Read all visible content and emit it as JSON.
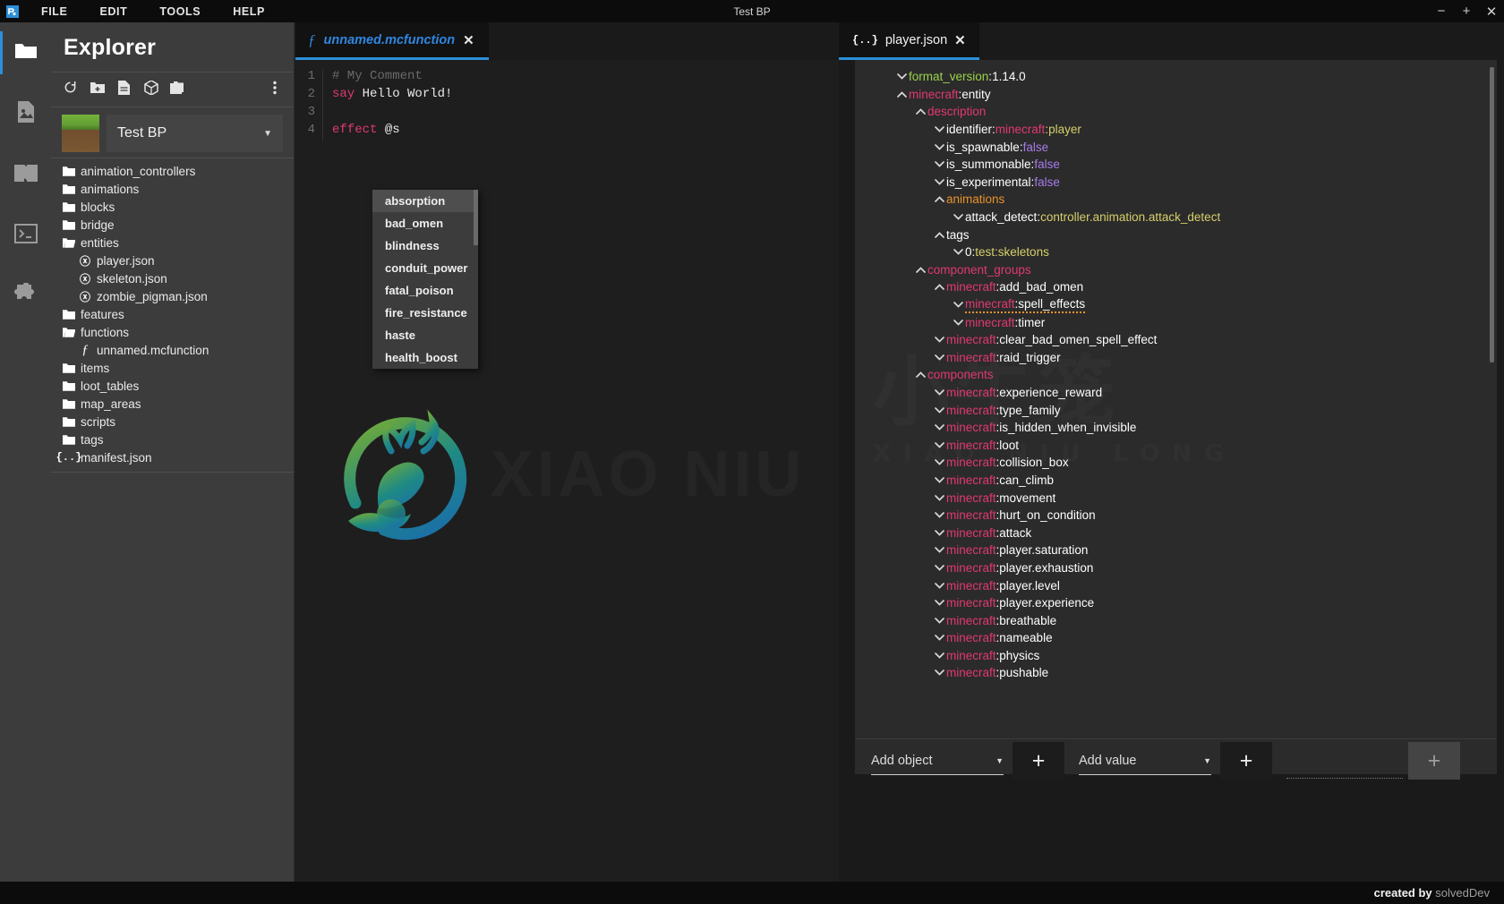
{
  "window": {
    "title": "Test BP",
    "menus": [
      "FILE",
      "EDIT",
      "TOOLS",
      "HELP"
    ],
    "minimize": "−",
    "maximize": "+",
    "close": "✕"
  },
  "rail": {
    "items": [
      {
        "name": "files",
        "icon": "folder-icon",
        "active": true
      },
      {
        "name": "images",
        "icon": "image-file-icon",
        "active": false
      },
      {
        "name": "docs",
        "icon": "book-icon",
        "active": false
      },
      {
        "name": "terminal",
        "icon": "terminal-icon",
        "active": false
      },
      {
        "name": "extensions",
        "icon": "puzzle-icon",
        "active": false
      }
    ]
  },
  "explorer": {
    "title": "Explorer",
    "tools": [
      {
        "name": "refresh",
        "icon": "refresh-icon"
      },
      {
        "name": "new-folder",
        "icon": "new-folder-icon"
      },
      {
        "name": "new-file",
        "icon": "new-file-icon"
      },
      {
        "name": "new-package",
        "icon": "package-icon"
      },
      {
        "name": "open-folder",
        "icon": "folder-open-icon"
      },
      {
        "name": "more-options",
        "icon": "kebab-menu-icon"
      }
    ],
    "project": {
      "name": "Test BP",
      "caret": "▼"
    },
    "tree": [
      {
        "label": "animation_controllers",
        "type": "folder",
        "depth": 0,
        "open": false
      },
      {
        "label": "animations",
        "type": "folder",
        "depth": 0,
        "open": false
      },
      {
        "label": "blocks",
        "type": "folder",
        "depth": 0,
        "open": false
      },
      {
        "label": "bridge",
        "type": "folder",
        "depth": 0,
        "open": false
      },
      {
        "label": "entities",
        "type": "folder",
        "depth": 0,
        "open": true
      },
      {
        "label": "player.json",
        "type": "json",
        "depth": 1,
        "open": false
      },
      {
        "label": "skeleton.json",
        "type": "json",
        "depth": 1,
        "open": false
      },
      {
        "label": "zombie_pigman.json",
        "type": "json",
        "depth": 1,
        "open": false
      },
      {
        "label": "features",
        "type": "folder",
        "depth": 0,
        "open": false
      },
      {
        "label": "functions",
        "type": "folder",
        "depth": 0,
        "open": true
      },
      {
        "label": "unnamed.mcfunction",
        "type": "function",
        "depth": 1,
        "open": false
      },
      {
        "label": "items",
        "type": "folder",
        "depth": 0,
        "open": false
      },
      {
        "label": "loot_tables",
        "type": "folder",
        "depth": 0,
        "open": false
      },
      {
        "label": "map_areas",
        "type": "folder",
        "depth": 0,
        "open": false
      },
      {
        "label": "scripts",
        "type": "folder",
        "depth": 0,
        "open": false
      },
      {
        "label": "tags",
        "type": "folder",
        "depth": 0,
        "open": false
      },
      {
        "label": "manifest.json",
        "type": "manifest",
        "depth": 0,
        "open": false
      }
    ]
  },
  "editor": {
    "tab": {
      "label": "unnamed.mcfunction",
      "icon": "function-icon",
      "close": "✕",
      "active": true
    },
    "lines": [
      {
        "number": "1",
        "tokens": [
          {
            "text": "# My Comment",
            "cls": "c-comment"
          }
        ]
      },
      {
        "number": "2",
        "tokens": [
          {
            "text": "say",
            "cls": "c-cmd"
          },
          {
            "text": " Hello World!",
            "cls": "c-str"
          }
        ]
      },
      {
        "number": "3",
        "tokens": []
      },
      {
        "number": "4",
        "tokens": [
          {
            "text": "effect",
            "cls": "c-cmd"
          },
          {
            "text": " @s",
            "cls": "c-sel"
          }
        ]
      }
    ],
    "autocomplete": {
      "selected": "absorption",
      "items": [
        "absorption",
        "bad_omen",
        "blindness",
        "conduit_power",
        "fatal_poison",
        "fire_resistance",
        "haste",
        "health_boost"
      ]
    },
    "watermark": "XIAO NIU"
  },
  "json_panel": {
    "tab": {
      "label": "player.json",
      "icon": "json-file-icon",
      "close": "✕",
      "active": true
    },
    "watermark": {
      "line1": "小牛笼",
      "line2": "XIAO NIU LONG"
    },
    "rows": [
      {
        "depth": 0,
        "chev": "down",
        "key": "format_version",
        "key_cls": "k-green",
        "sep": " : ",
        "value": "1.14.0",
        "value_cls": "v-num"
      },
      {
        "depth": 0,
        "chev": "up",
        "ns": "minecraft",
        "key": ":entity",
        "key_cls": "k-plain"
      },
      {
        "depth": 1,
        "chev": "up",
        "key": "description",
        "key_cls": "k-pink"
      },
      {
        "depth": 2,
        "chev": "down",
        "key": "identifier",
        "key_cls": "k-plain",
        "sep": " : ",
        "ns_value": "minecraft",
        "value": ":player",
        "value_cls": "v-yellow"
      },
      {
        "depth": 2,
        "chev": "down",
        "key": "is_spawnable",
        "key_cls": "k-plain",
        "sep": " : ",
        "value": "false",
        "value_cls": "v-purple"
      },
      {
        "depth": 2,
        "chev": "down",
        "key": "is_summonable",
        "key_cls": "k-plain",
        "sep": " : ",
        "value": "false",
        "value_cls": "v-purple"
      },
      {
        "depth": 2,
        "chev": "down",
        "key": "is_experimental",
        "key_cls": "k-plain",
        "sep": " : ",
        "value": "false",
        "value_cls": "v-purple"
      },
      {
        "depth": 2,
        "chev": "up",
        "key": "animations",
        "key_cls": "k-orange"
      },
      {
        "depth": 3,
        "chev": "down",
        "key": "attack_detect",
        "key_cls": "k-plain",
        "sep": " : ",
        "value": "controller.animation.attack_detect",
        "value_cls": "v-yellow"
      },
      {
        "depth": 2,
        "chev": "up",
        "key": "tags",
        "key_cls": "k-plain"
      },
      {
        "depth": 3,
        "chev": "down",
        "key": "0",
        "key_cls": "k-plain",
        "sep": " : ",
        "value": "test:skeletons",
        "value_cls": "v-yellow"
      },
      {
        "depth": 1,
        "chev": "up",
        "key": "component_groups",
        "key_cls": "k-pink"
      },
      {
        "depth": 2,
        "chev": "up",
        "ns": "minecraft",
        "key": ":add_bad_omen",
        "key_cls": "k-plain"
      },
      {
        "depth": 3,
        "chev": "down",
        "ns": "minecraft",
        "key": ":spell_effects",
        "key_cls": "k-plain",
        "warn": true
      },
      {
        "depth": 3,
        "chev": "down",
        "ns": "minecraft",
        "key": ":timer",
        "key_cls": "k-plain"
      },
      {
        "depth": 2,
        "chev": "down",
        "ns": "minecraft",
        "key": ":clear_bad_omen_spell_effect",
        "key_cls": "k-plain"
      },
      {
        "depth": 2,
        "chev": "down",
        "ns": "minecraft",
        "key": ":raid_trigger",
        "key_cls": "k-plain"
      },
      {
        "depth": 1,
        "chev": "up",
        "key": "components",
        "key_cls": "k-pink"
      },
      {
        "depth": 2,
        "chev": "down",
        "ns": "minecraft",
        "key": ":experience_reward",
        "key_cls": "k-plain"
      },
      {
        "depth": 2,
        "chev": "down",
        "ns": "minecraft",
        "key": ":type_family",
        "key_cls": "k-plain"
      },
      {
        "depth": 2,
        "chev": "down",
        "ns": "minecraft",
        "key": ":is_hidden_when_invisible",
        "key_cls": "k-plain"
      },
      {
        "depth": 2,
        "chev": "down",
        "ns": "minecraft",
        "key": ":loot",
        "key_cls": "k-plain"
      },
      {
        "depth": 2,
        "chev": "down",
        "ns": "minecraft",
        "key": ":collision_box",
        "key_cls": "k-plain"
      },
      {
        "depth": 2,
        "chev": "down",
        "ns": "minecraft",
        "key": ":can_climb",
        "key_cls": "k-plain"
      },
      {
        "depth": 2,
        "chev": "down",
        "ns": "minecraft",
        "key": ":movement",
        "key_cls": "k-plain"
      },
      {
        "depth": 2,
        "chev": "down",
        "ns": "minecraft",
        "key": ":hurt_on_condition",
        "key_cls": "k-plain"
      },
      {
        "depth": 2,
        "chev": "down",
        "ns": "minecraft",
        "key": ":attack",
        "key_cls": "k-plain"
      },
      {
        "depth": 2,
        "chev": "down",
        "ns": "minecraft",
        "key": ":player.saturation",
        "key_cls": "k-plain"
      },
      {
        "depth": 2,
        "chev": "down",
        "ns": "minecraft",
        "key": ":player.exhaustion",
        "key_cls": "k-plain"
      },
      {
        "depth": 2,
        "chev": "down",
        "ns": "minecraft",
        "key": ":player.level",
        "key_cls": "k-plain"
      },
      {
        "depth": 2,
        "chev": "down",
        "ns": "minecraft",
        "key": ":player.experience",
        "key_cls": "k-plain"
      },
      {
        "depth": 2,
        "chev": "down",
        "ns": "minecraft",
        "key": ":breathable",
        "key_cls": "k-plain"
      },
      {
        "depth": 2,
        "chev": "down",
        "ns": "minecraft",
        "key": ":nameable",
        "key_cls": "k-plain"
      },
      {
        "depth": 2,
        "chev": "down",
        "ns": "minecraft",
        "key": ":physics",
        "key_cls": "k-plain"
      },
      {
        "depth": 2,
        "chev": "down",
        "ns": "minecraft",
        "key": ":pushable",
        "key_cls": "k-plain"
      }
    ],
    "addbar": {
      "object_select": "Add object",
      "value_select": "Add value",
      "caret": "▼",
      "plus": "+"
    }
  },
  "statusbar": {
    "created_by": "created by",
    "author": "solvedDev"
  },
  "colors": {
    "accent": "#2c8fd8",
    "key_pink": "#e0396f",
    "value_yellow": "#d6cf6a",
    "value_purple": "#a77bea",
    "green": "#9bd14a",
    "orange": "#e8922a"
  }
}
